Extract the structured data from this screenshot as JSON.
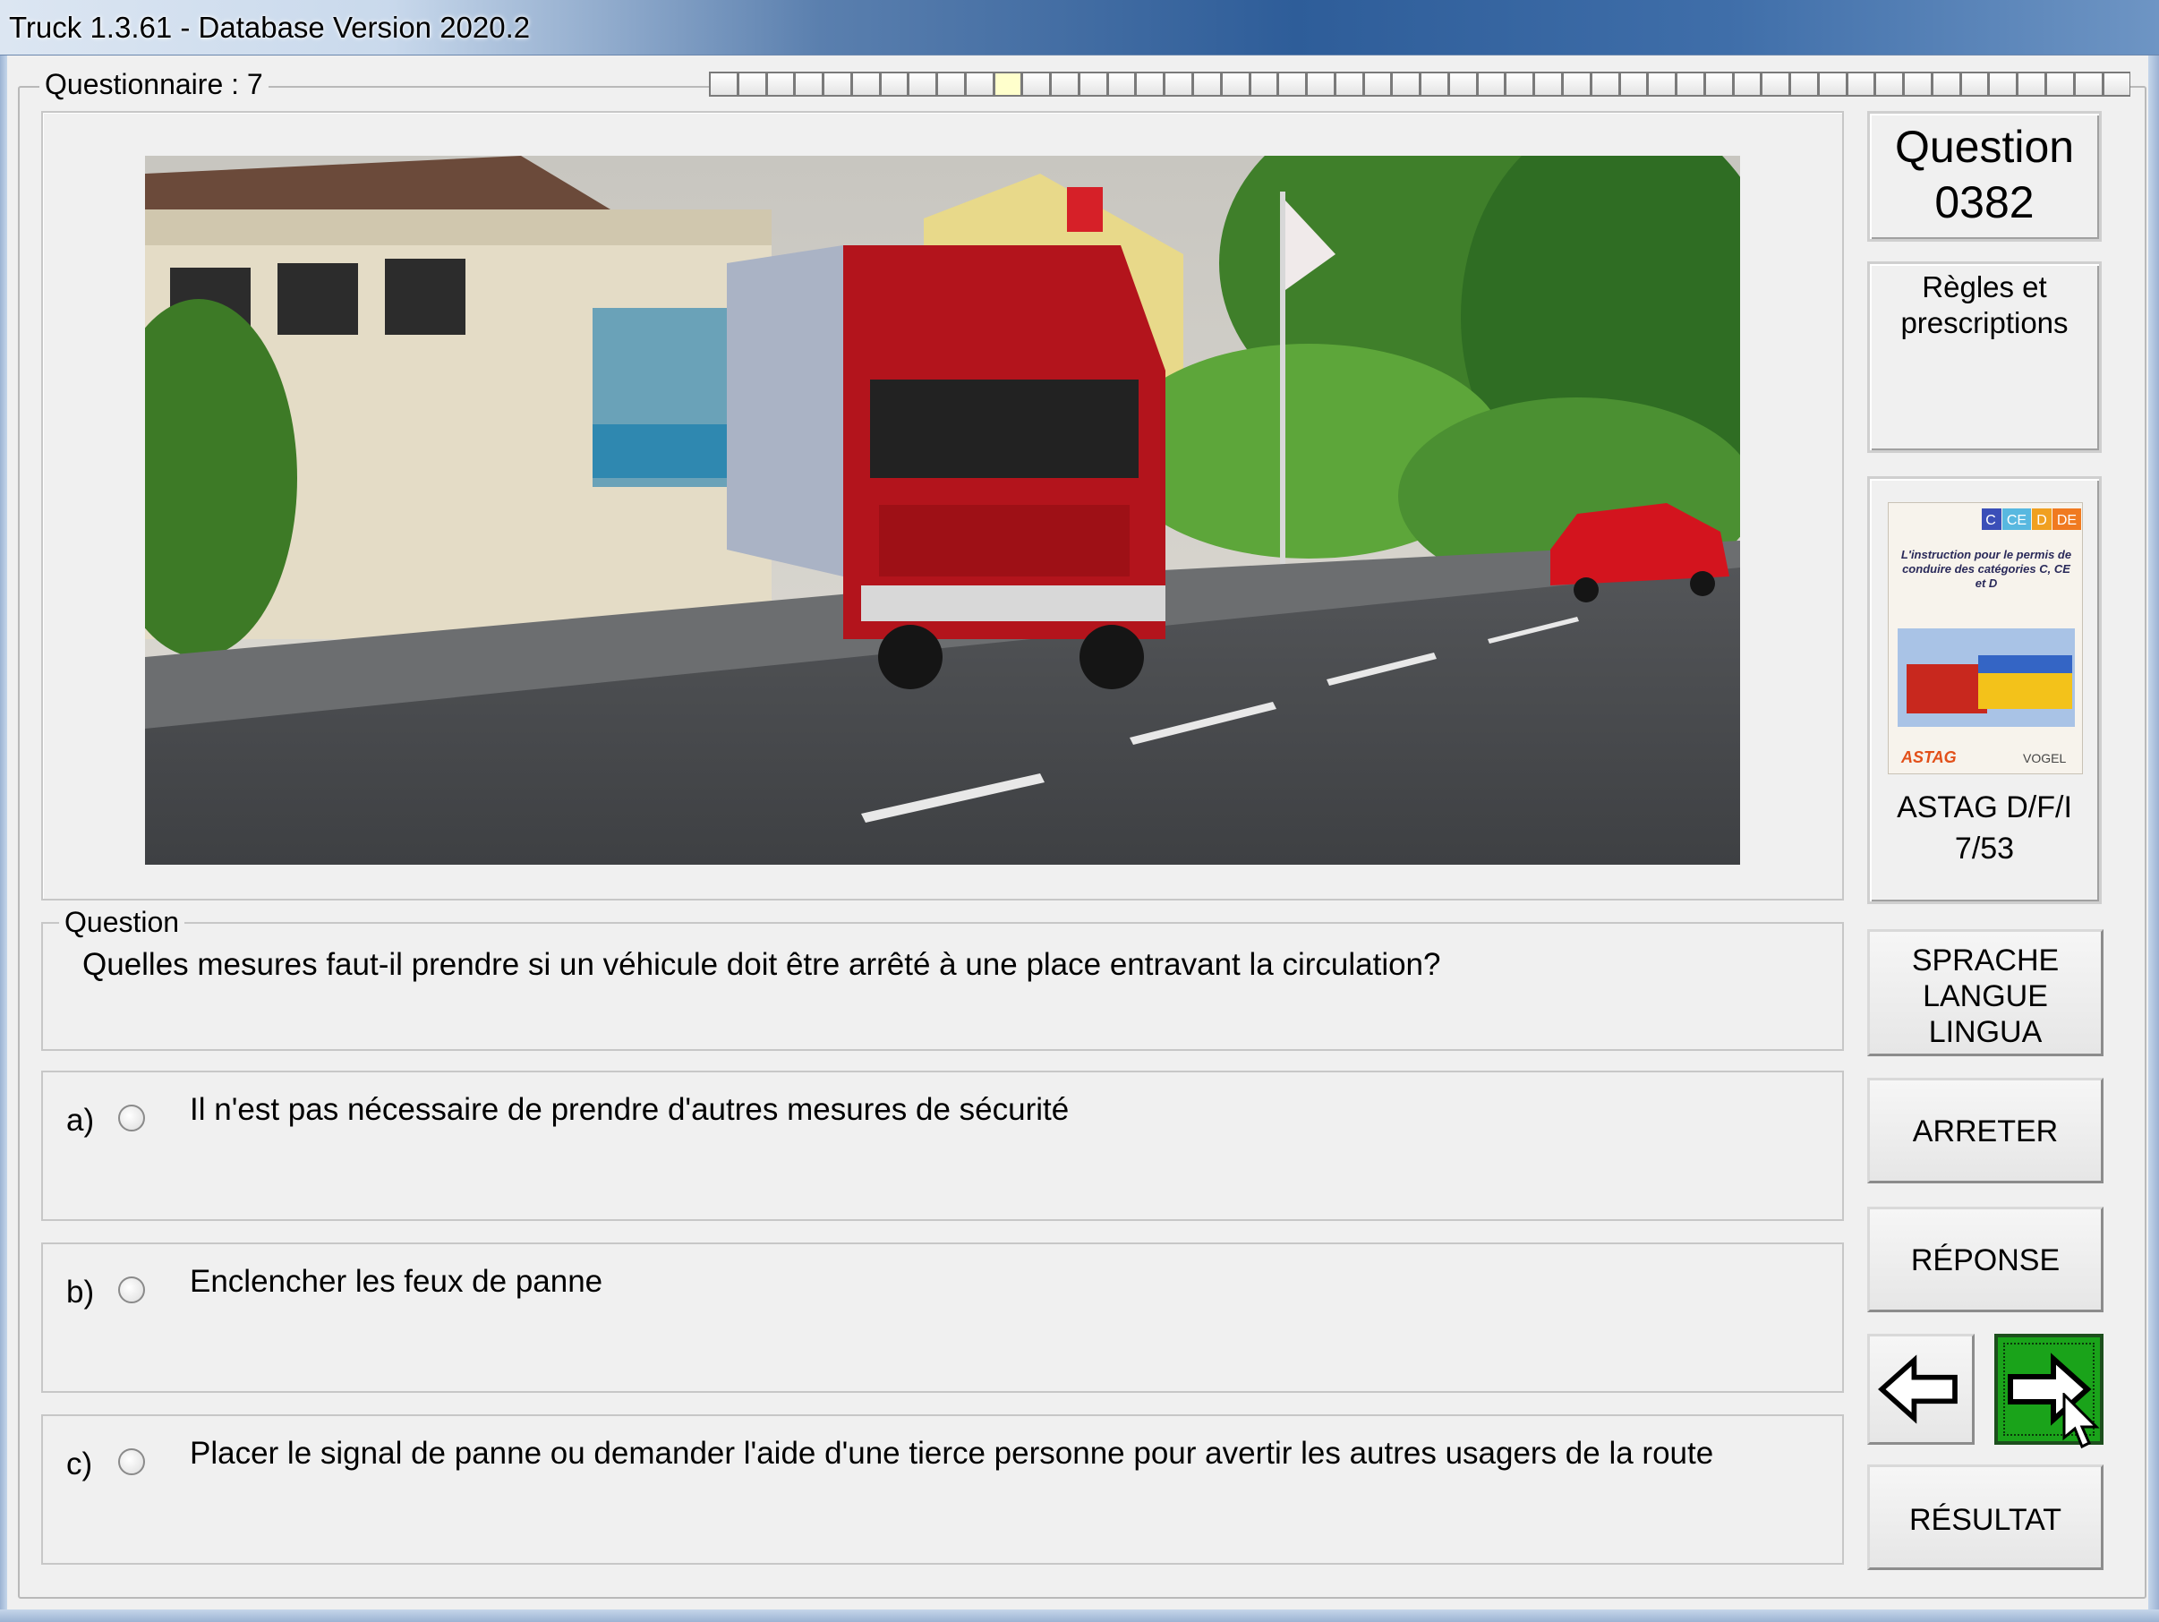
{
  "window": {
    "title": "Truck 1.3.61 - Database Version 2020.2"
  },
  "questionnaire": {
    "label": "Questionnaire : 7",
    "progress_total": 50,
    "progress_current": 10
  },
  "question_panel": {
    "number_label": "Question",
    "number": "0382",
    "category": "Règles et prescriptions",
    "legend": "Question",
    "text": "Quelles mesures faut-il prendre si un véhicule doit être arrêté à une place entravant la circulation?"
  },
  "answers": [
    {
      "letter": "a)",
      "text": "Il n'est pas nécessaire de prendre d'autres mesures de sécurité",
      "selected": false
    },
    {
      "letter": "b)",
      "text": "Enclencher les feux de panne",
      "selected": false
    },
    {
      "letter": "c)",
      "text": "Placer le signal de panne ou demander l'aide d'une tierce personne pour avertir les autres usagers de la route",
      "selected": false
    }
  ],
  "source": {
    "book_badges": [
      "C",
      "CE",
      "D",
      "DE"
    ],
    "book_title": "L'instruction pour le permis de conduire des catégories C, CE et D",
    "publisher_left": "ASTAG",
    "publisher_right": "VOGEL",
    "line1": "ASTAG D/F/I",
    "line2": "7/53"
  },
  "buttons": {
    "language": [
      "SPRACHE",
      "LANGUE",
      "LINGUA"
    ],
    "stop": "ARRETER",
    "answer": "RÉPONSE",
    "prev_icon": "arrow-left-icon",
    "next_icon": "arrow-right-icon",
    "result": "RÉSULTAT"
  },
  "colors": {
    "next_button": "#1aa31a",
    "truck_cab": "#b3141c",
    "car": "#d3141e"
  }
}
